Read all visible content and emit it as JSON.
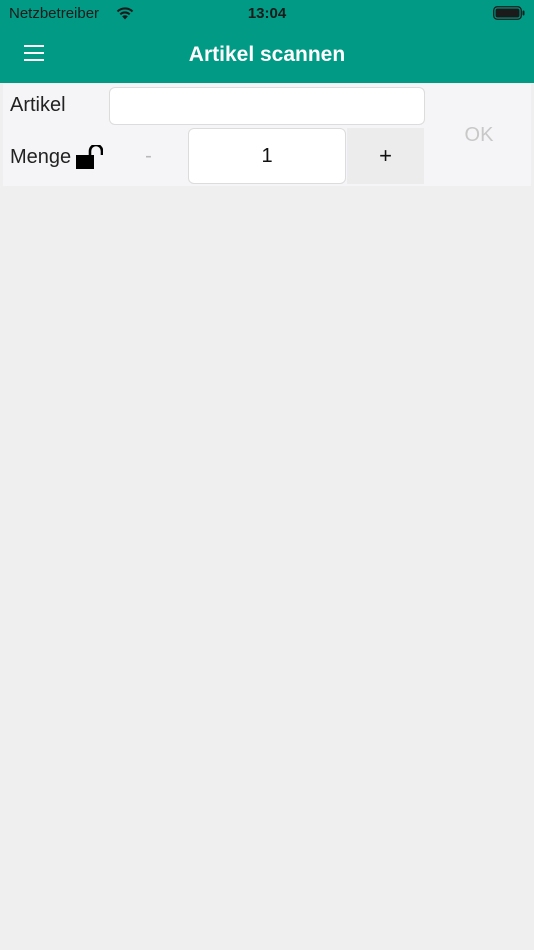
{
  "status_bar": {
    "carrier": "Netzbetreiber",
    "time": "13:04"
  },
  "header": {
    "title": "Artikel scannen",
    "menu_icon": "hamburger-menu-icon"
  },
  "form": {
    "artikel_label": "Artikel",
    "artikel_value": "",
    "menge_label": "Menge",
    "lock_icon": "unlocked-padlock-icon",
    "minus_label": "-",
    "quantity": "1",
    "plus_label": "+",
    "ok_label": "OK"
  },
  "colors": {
    "header": "#009a85",
    "background": "#efefef",
    "form_background": "#f5f5f7",
    "disabled_text": "#c8c8c8"
  }
}
